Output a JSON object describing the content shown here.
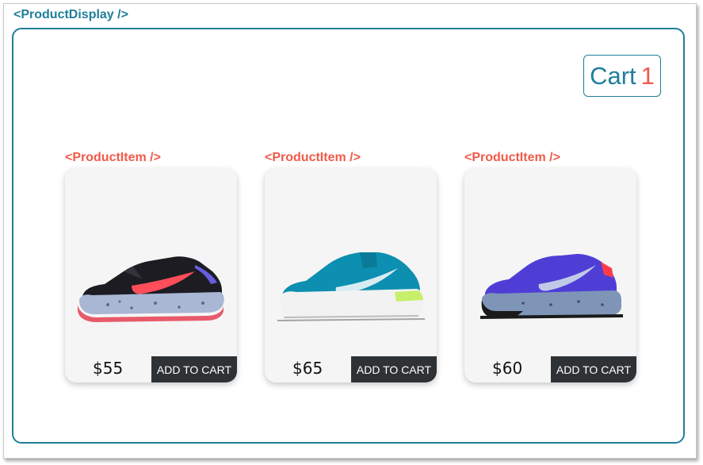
{
  "product_display": {
    "label": "<ProductDisplay />"
  },
  "cart": {
    "label": "Cart",
    "count": "1"
  },
  "products": [
    {
      "component_label": "<ProductItem />",
      "price": "$55",
      "button_label": "ADD TO CART",
      "shoe_icon": "trail-running-shoe-black-red-icon",
      "colors": {
        "upper": "#1c1c22",
        "accent": "#ff4d5a",
        "sole": "#a9b7d4",
        "trim": "#e85a6a"
      }
    },
    {
      "component_label": "<ProductItem />",
      "price": "$65",
      "button_label": "ADD TO CART",
      "shoe_icon": "running-shoe-teal-icon",
      "colors": {
        "upper": "#0c8fb0",
        "accent": "#d6ecf2",
        "sole": "#f2f2f2",
        "trim": "#c8ef6a"
      }
    },
    {
      "component_label": "<ProductItem />",
      "price": "$60",
      "button_label": "ADD TO CART",
      "shoe_icon": "trail-running-shoe-purple-icon",
      "colors": {
        "upper": "#4f3ed6",
        "accent": "#c0cae8",
        "sole": "#7f95b8",
        "trim": "#1a1a1a"
      }
    }
  ],
  "colors": {
    "display_accent": "#1f7e99",
    "item_accent": "#f05a4a",
    "button_bg": "#2e3235",
    "card_bg": "#f5f5f5"
  }
}
